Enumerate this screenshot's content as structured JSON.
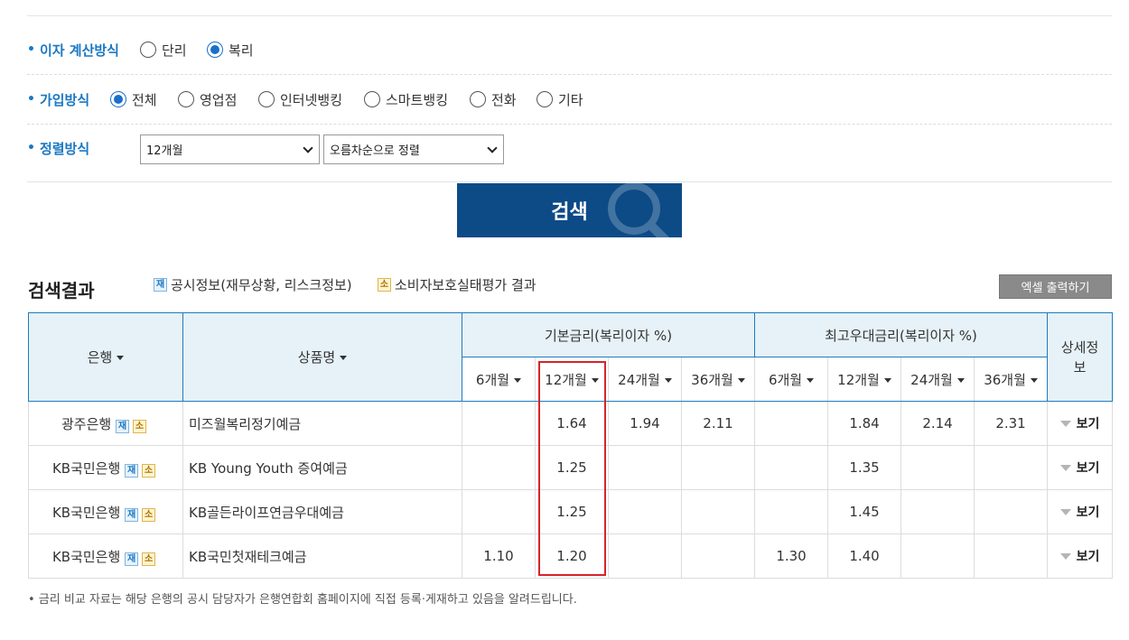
{
  "filters": {
    "interest": {
      "label": "이자 계산방식",
      "options": [
        {
          "label": "단리",
          "selected": false
        },
        {
          "label": "복리",
          "selected": true
        }
      ]
    },
    "join": {
      "label": "가입방식",
      "options": [
        {
          "label": "전체",
          "selected": true
        },
        {
          "label": "영업점",
          "selected": false
        },
        {
          "label": "인터넷뱅킹",
          "selected": false
        },
        {
          "label": "스마트뱅킹",
          "selected": false
        },
        {
          "label": "전화",
          "selected": false
        },
        {
          "label": "기타",
          "selected": false
        }
      ]
    },
    "sort": {
      "label": "정렬방식",
      "period_value": "12개월",
      "order_value": "오름차순으로 정렬"
    }
  },
  "search_button": "검색",
  "results": {
    "title": "검색결과",
    "legend_jae_badge": "재",
    "legend_jae": "공시정보(재무상황, 리스크정보)",
    "legend_so_badge": "소",
    "legend_so": "소비자보호실태평가 결과",
    "excel_button": "엑셀 출력하기"
  },
  "table": {
    "col_bank": "은행",
    "col_product": "상품명",
    "group_base": "기본금리(복리이자 %)",
    "group_max": "최고우대금리(복리이자 %)",
    "col_detail": "상세정보",
    "periods": [
      "6개월",
      "12개월",
      "24개월",
      "36개월"
    ],
    "badge_jae": "재",
    "badge_so": "소",
    "view_label": "보기",
    "rows": [
      {
        "bank": "광주은행",
        "product": "미즈월복리정기예금",
        "base": [
          "",
          "1.64",
          "1.94",
          "2.11"
        ],
        "max": [
          "",
          "1.84",
          "2.14",
          "2.31"
        ]
      },
      {
        "bank": "KB국민은행",
        "product": "KB Young Youth 증여예금",
        "base": [
          "",
          "1.25",
          "",
          ""
        ],
        "max": [
          "",
          "1.35",
          "",
          ""
        ]
      },
      {
        "bank": "KB국민은행",
        "product": "KB골든라이프연금우대예금",
        "base": [
          "",
          "1.25",
          "",
          ""
        ],
        "max": [
          "",
          "1.45",
          "",
          ""
        ]
      },
      {
        "bank": "KB국민은행",
        "product": "KB국민첫재테크예금",
        "base": [
          "1.10",
          "1.20",
          "",
          ""
        ],
        "max": [
          "1.30",
          "1.40",
          "",
          ""
        ]
      }
    ]
  },
  "footnote": "• 금리 비교 자료는 해당 은행의 공시 담당자가 은행연합회 홈페이지에 직접 등록·게재하고 있음을 알려드립니다.",
  "colors": {
    "accent": "#1a78c2",
    "button": "#0d4b87",
    "highlight": "#d6242a"
  }
}
